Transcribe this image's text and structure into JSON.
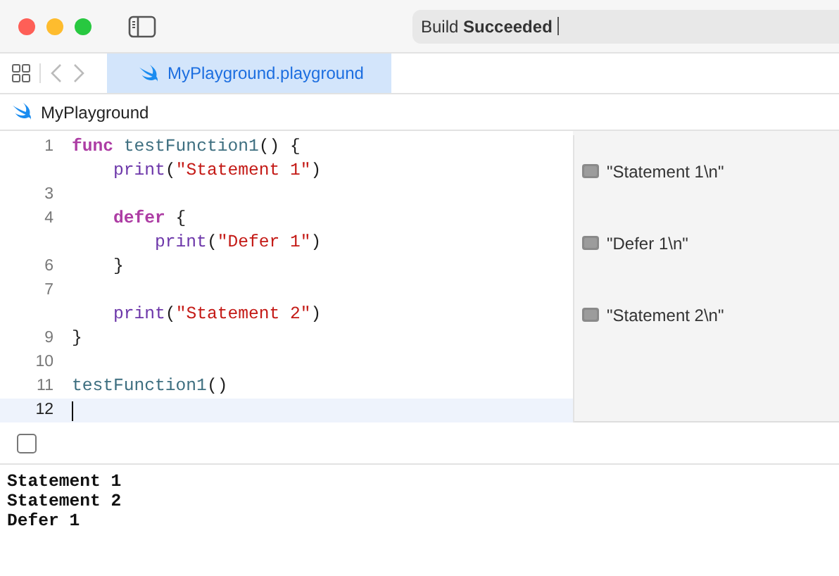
{
  "window": {
    "status": "Build **Succeeded**"
  },
  "tabs": [
    {
      "label": "MyPlayground.playground",
      "selected": true
    }
  ],
  "navigation": {
    "back_disabled": true,
    "forward_disabled": true
  },
  "breadcrumb": {
    "label": "MyPlayground"
  },
  "editor": {
    "lines": [
      {
        "number": "1",
        "current": false,
        "tokens": [
          {
            "kind": "keyword",
            "text": "func"
          },
          {
            "kind": "function",
            "text": " testFunction1"
          },
          {
            "kind": "plain",
            "text": "() {"
          }
        ]
      },
      {
        "current": false,
        "tokens": [
          {
            "kind": "builtin",
            "text": "    print"
          },
          {
            "kind": "plain",
            "text": "("
          },
          {
            "kind": "string",
            "text": "\"Statement 1\""
          },
          {
            "kind": "plain",
            "text": ")"
          }
        ],
        "result": "\"Statement 1\\n\""
      },
      {
        "number": "3",
        "current": false
      },
      {
        "number": "4",
        "current": false,
        "tokens": [
          {
            "kind": "keyword",
            "text": "    defer"
          },
          {
            "kind": "plain",
            "text": " {"
          }
        ]
      },
      {
        "current": false,
        "tokens": [
          {
            "kind": "builtin",
            "text": "        print"
          },
          {
            "kind": "plain",
            "text": "("
          },
          {
            "kind": "string",
            "text": "\"Defer 1\""
          },
          {
            "kind": "plain",
            "text": ")"
          }
        ],
        "result": "\"Defer 1\\n\""
      },
      {
        "number": "6",
        "current": false,
        "tokens": [
          {
            "kind": "plain",
            "text": "    }"
          }
        ]
      },
      {
        "number": "7",
        "current": false
      },
      {
        "current": false,
        "tokens": [
          {
            "kind": "builtin",
            "text": "    print"
          },
          {
            "kind": "plain",
            "text": "("
          },
          {
            "kind": "string",
            "text": "\"Statement 2\""
          },
          {
            "kind": "plain",
            "text": ")"
          }
        ],
        "result": "\"Statement 2\\n\""
      },
      {
        "number": "9",
        "current": false,
        "tokens": [
          {
            "kind": "plain",
            "text": "}"
          }
        ]
      },
      {
        "number": "10",
        "current": false
      },
      {
        "number": "11",
        "current": false,
        "tokens": [
          {
            "kind": "function",
            "text": "testFunction1"
          },
          {
            "kind": "plain",
            "text": "()"
          }
        ]
      },
      {
        "number": "12",
        "current": true
      }
    ]
  },
  "console": {
    "output": [
      "Statement 1",
      "Statement 2",
      "Defer 1"
    ]
  }
}
